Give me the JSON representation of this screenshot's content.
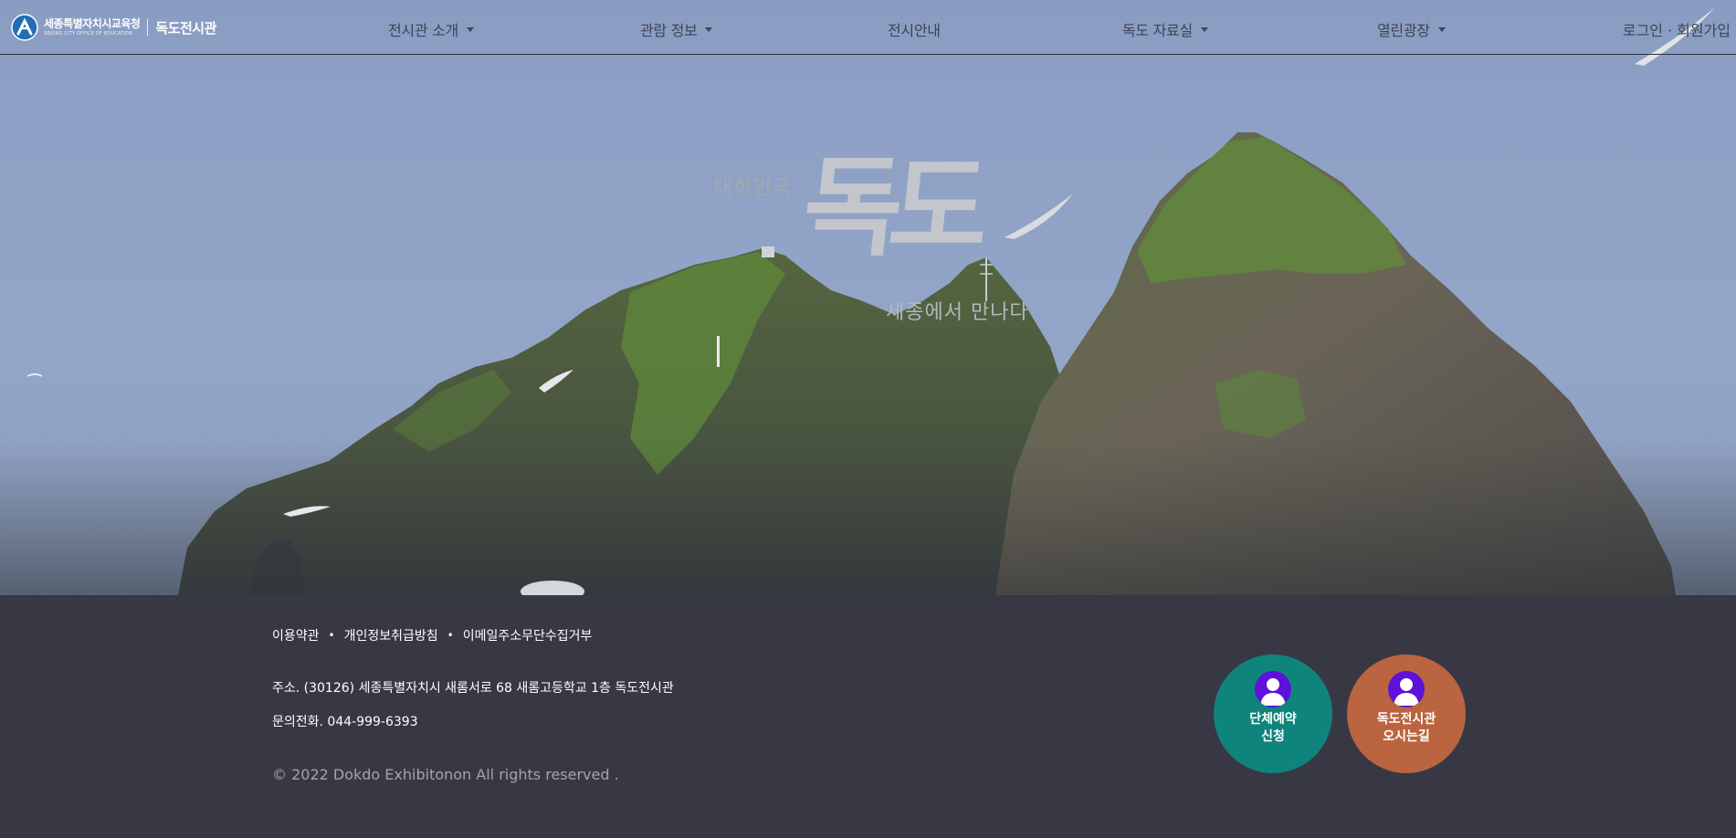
{
  "header": {
    "logo_org": "세종특별자치시교육청",
    "logo_sub": "SEJONG CITY OFFICE OF EDUCATION",
    "site_name": "독도전시관",
    "nav": [
      {
        "label": "전시관 소개",
        "dropdown": true
      },
      {
        "label": "관람 정보",
        "dropdown": true
      },
      {
        "label": "전시안내",
        "dropdown": false
      },
      {
        "label": "독도 자료실",
        "dropdown": true
      },
      {
        "label": "열린광장",
        "dropdown": true
      }
    ],
    "login": "로그인",
    "auth_sep": "·",
    "signup": "회원가입"
  },
  "hero": {
    "title_small": "대한민국",
    "title_big": "독도",
    "tagline": "세종에서 만나다"
  },
  "footer": {
    "links": [
      "이용약관",
      "개인정보취급방침",
      "이메일주소무단수집거부"
    ],
    "link_sep": "•",
    "address": "주소. (30126) 세종특별자치시 새롬서로 68 새롬고등학교 1층 독도전시관",
    "phone": "문의전화. 044-999-6393",
    "copyright": "© 2022 Dokdo Exhibitonon All rights reserved .",
    "buttons": [
      {
        "line1": "단체예약",
        "line2": "신청",
        "icon": "user-icon",
        "color": "#0f847c"
      },
      {
        "line1": "독도전시관",
        "line2": "오시는길",
        "icon": "user-icon",
        "color": "#bb6440"
      }
    ]
  },
  "colors": {
    "footer_bg": "#383845",
    "avatar_badge": "#5e11d9",
    "hero_sky": "#8fa2c6"
  }
}
